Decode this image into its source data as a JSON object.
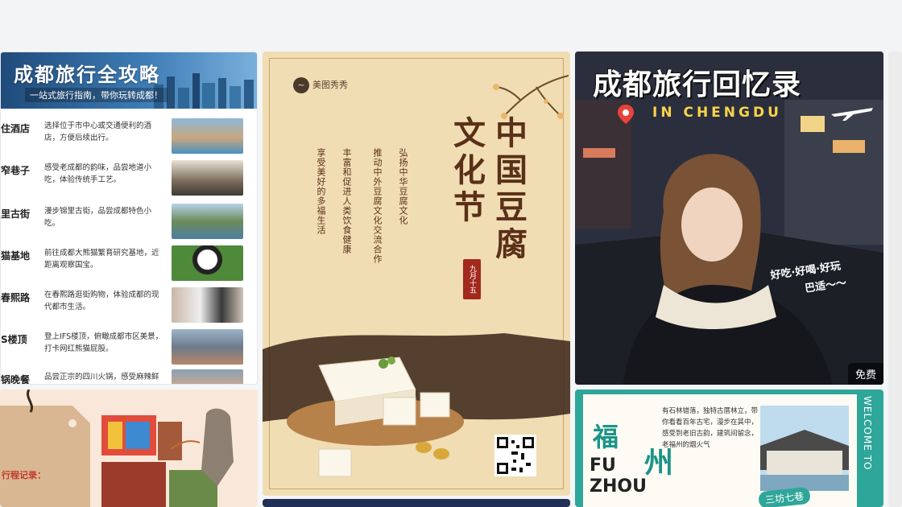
{
  "cards": {
    "guide": {
      "title": "成都旅行全攻略",
      "subtitle": "一站式旅行指南，带你玩转成都！",
      "items": [
        {
          "name": "住酒店",
          "desc": "选择位于市中心或交通便利的酒店，方便后续出行。"
        },
        {
          "name": "窄巷子",
          "desc": "感受老成都的韵味，品尝地道小吃，体验传统手工艺。"
        },
        {
          "name": "里古街",
          "desc": "漫步锦里古街，品尝成都特色小吃。"
        },
        {
          "name": "猫基地",
          "desc": "前往成都大熊猫繁育研究基地，近距离观察国宝。"
        },
        {
          "name": "春熙路",
          "desc": "在春熙路逛街购物，体验成都的现代都市生活。"
        },
        {
          "name": "S楼顶",
          "desc": "登上IFS楼顶，俯瞰成都市区美景，打卡网红熊猫屁股。"
        },
        {
          "name": "锅晚餐",
          "desc": "品尝正宗的四川火锅，感受麻辣鲜香的味觉盛宴。"
        }
      ]
    },
    "tofu": {
      "brand": "美图秀秀",
      "title_right": "中国豆腐",
      "title_left": "文化节",
      "date": "九月十五",
      "col1": "弘扬中华豆腐文化",
      "col2": "推动中外豆腐文化交流合作",
      "col3": "丰富和促进人类饮食健康",
      "col4": "享受美好的多福生活"
    },
    "memories": {
      "title": "成都旅行回忆录",
      "subtitle": "IN CHENGDU",
      "hand1": "好吃·好喝·好玩",
      "hand2": "巴适～～",
      "tag": "免费"
    },
    "fuzhou": {
      "big1": "福",
      "big2": "州",
      "en1": "FU",
      "en2": "ZHOU",
      "para": "有石林错落，独特古厝林立，带你看看百年古宅，漫步在其中，感受到老旧古韵，建筑间留念，老福州的烟火气",
      "welcome": "WELCOME TO",
      "badge": "三坊七巷"
    },
    "stamp": {
      "caption": "行程记录："
    }
  },
  "colors": {
    "tofu_brown": "#5a3018",
    "accent_red": "#a3281e",
    "fuzhou_teal": "#2fa69a",
    "guide_blue": "#1f4b7a"
  }
}
